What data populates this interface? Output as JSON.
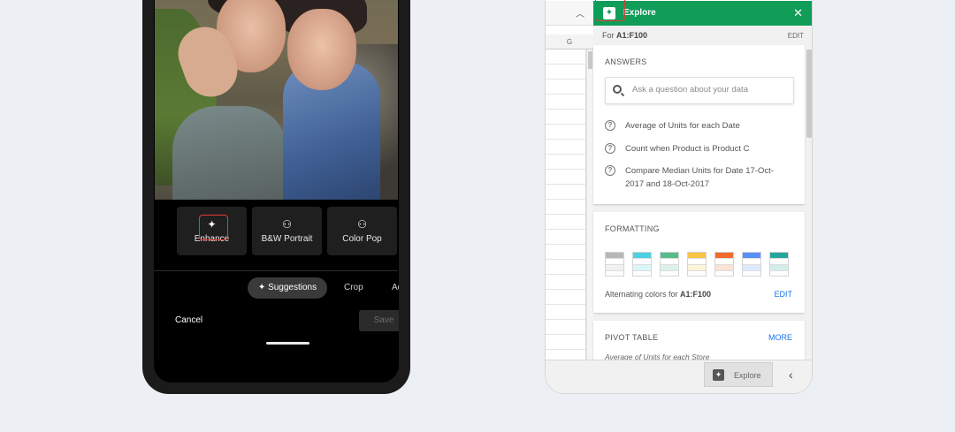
{
  "phone": {
    "suggestion_cards": [
      {
        "label": "Enhance",
        "icon": "sparkle-icon"
      },
      {
        "label": "B&W Portrait",
        "icon": "person-icon"
      },
      {
        "label": "Color Pop",
        "icon": "person-icon"
      }
    ],
    "tabs": {
      "suggestions": "Suggestions",
      "crop": "Crop",
      "adjust": "Adju"
    },
    "cancel_label": "Cancel",
    "save_label": "Save"
  },
  "sheets": {
    "column_header": "G",
    "explore": {
      "title": "Explore",
      "close": "✕",
      "range_prefix": "For ",
      "range": "A1:F100",
      "range_edit": "EDIT"
    },
    "answers": {
      "heading": "ANSWERS",
      "search_placeholder": "Ask a question about your data",
      "questions": [
        "Average of Units for each Date",
        "Count when Product is Product C",
        "Compare Median Units for Date 17-Oct-2017 and 18-Oct-2017"
      ]
    },
    "formatting": {
      "heading": "FORMATTING",
      "swatch_colors": [
        "#b7b7b7",
        "#4dd0e1",
        "#57bb8a",
        "#f6c343",
        "#f26b2b",
        "#5b8ff9",
        "#26a69a"
      ],
      "alternating_prefix": "Alternating colors for ",
      "alternating_range": "A1:F100",
      "edit": "EDIT"
    },
    "pivot": {
      "heading": "PIVOT TABLE",
      "more": "MORE",
      "subtitle": "Average of Units for each Store"
    },
    "bottom": {
      "explore_label": "Explore",
      "collapse": "‹"
    }
  }
}
